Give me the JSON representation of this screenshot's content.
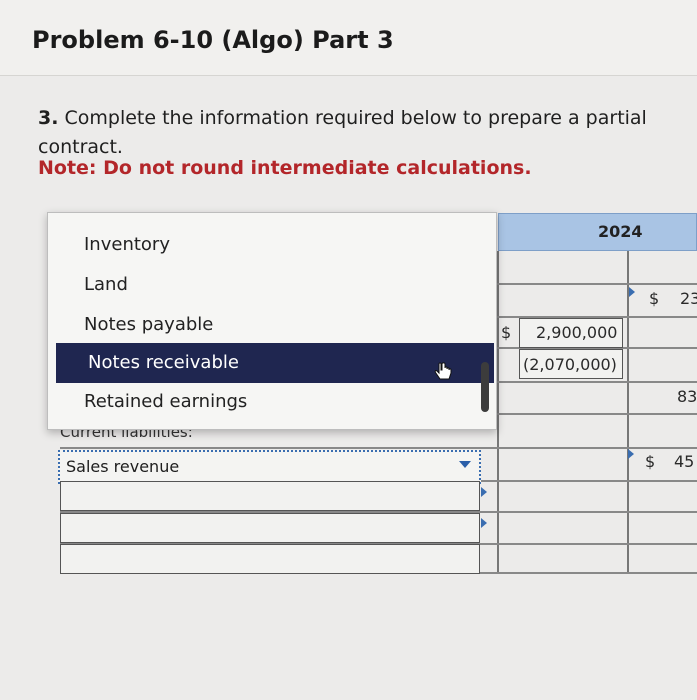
{
  "title": "Problem 6-10 (Algo) Part 3",
  "question": {
    "number": "3.",
    "line1": "Complete the information required below to prepare a partial",
    "line2": "contract.",
    "note": "Note: Do not round intermediate calculations."
  },
  "table": {
    "year_header": "2024",
    "row_dollar_1": "$",
    "row_partial_1": "23",
    "cell_dollar_2": "$",
    "amount_1": "2,900,000",
    "amount_2": "(2,070,000)",
    "row_partial_2": "83",
    "row_dollar_3": "$",
    "row_partial_3": "45"
  },
  "dropdown": {
    "items": [
      {
        "label": "Inventory",
        "selected": false
      },
      {
        "label": "Land",
        "selected": false
      },
      {
        "label": "Notes payable",
        "selected": false
      },
      {
        "label": "Notes receivable",
        "selected": true
      },
      {
        "label": "Retained earnings",
        "selected": false
      }
    ]
  },
  "partially_hidden_label": "Current liabilities:",
  "select": {
    "value": "Sales revenue"
  }
}
